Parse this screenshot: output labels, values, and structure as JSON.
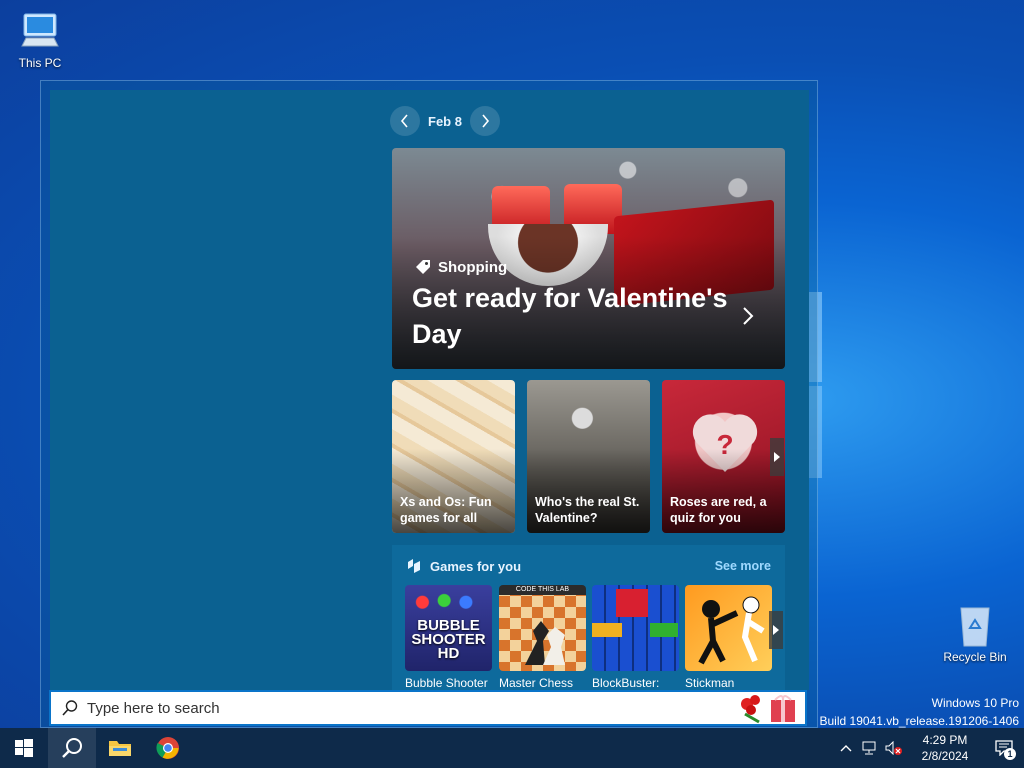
{
  "desktop": {
    "this_pc_label": "This PC",
    "recycle_bin_label": "Recycle Bin"
  },
  "date_nav": {
    "label": "Feb 8"
  },
  "hero": {
    "tag": "Shopping",
    "title": "Get ready for Valentine's Day"
  },
  "tiles": [
    {
      "caption": "Xs and Os: Fun games for all"
    },
    {
      "caption": "Who's the real St. Valentine?"
    },
    {
      "caption": "Roses are red, a quiz for you"
    }
  ],
  "games": {
    "heading": "Games for you",
    "see_more": "See more",
    "thumb_lettering": "BUBBLE SHOOTER HD",
    "chess_banner": "CODE THIS LAB",
    "items": [
      {
        "name": "Bubble Shooter"
      },
      {
        "name": "Master Chess"
      },
      {
        "name": "BlockBuster:"
      },
      {
        "name": "Stickman"
      }
    ]
  },
  "search": {
    "placeholder": "Type here to search"
  },
  "watermark": {
    "edition": "Windows 10 Pro",
    "build": "Build 19041.vb_release.191206-1406"
  },
  "taskbar": {
    "apps": [
      "start-button",
      "search-button",
      "file-explorer",
      "chrome"
    ]
  },
  "tray": {
    "time": "4:29 PM",
    "date": "2/8/2024",
    "notification_count": "1"
  },
  "colors": {
    "accent": "#0a74c9",
    "flyout_bg": "#0b6191",
    "taskbar_bg": "#0e2a4a",
    "see_more": "#9fd9ff"
  }
}
